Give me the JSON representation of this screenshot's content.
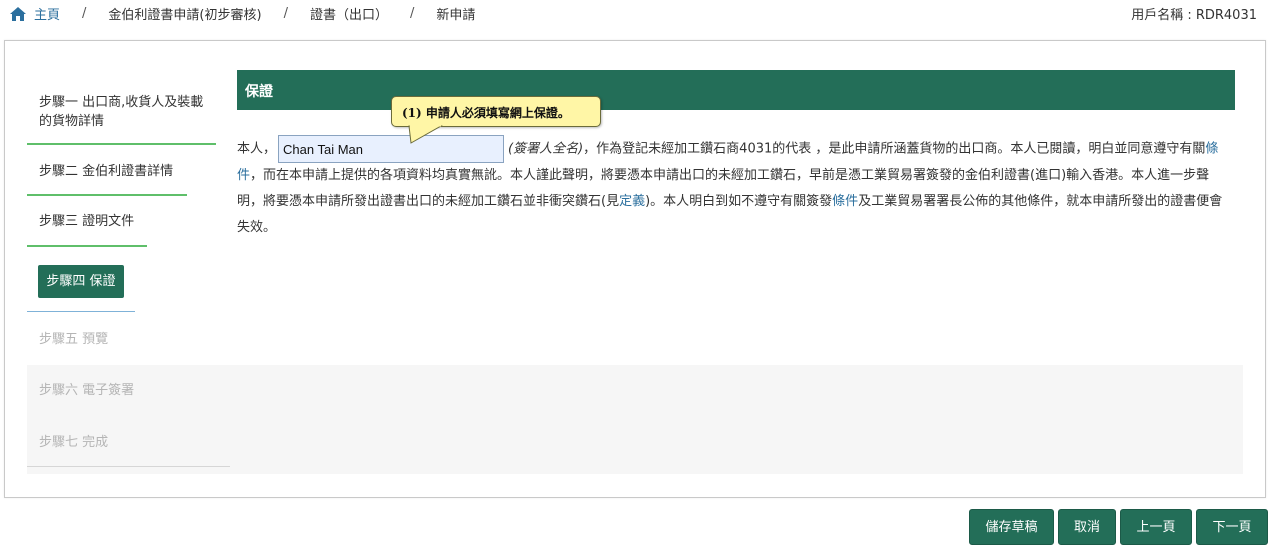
{
  "breadcrumb": {
    "home": "主頁",
    "items": [
      "金伯利證書申請(初步審核)",
      "證書（出口）",
      "新申請"
    ],
    "separator": "/"
  },
  "user_label": "用戶名稱 : RDR4031",
  "steps": [
    {
      "label": "步驟一 出口商,收貨人及裝載的貨物詳情",
      "state": "done"
    },
    {
      "label": "步驟二 金伯利證書詳情",
      "state": "done"
    },
    {
      "label": "步驟三 證明文件",
      "state": "done"
    },
    {
      "label": "步驟四 保證",
      "state": "active"
    },
    {
      "label": "步驟五 預覽",
      "state": "disabled"
    },
    {
      "label": "步驟六 電子簽署",
      "state": "disabled"
    },
    {
      "label": "步驟七 完成",
      "state": "disabled"
    }
  ],
  "section": {
    "title": "保證",
    "tooltip": "(1) 申請人必須填寫網上保證。"
  },
  "declaration": {
    "prefix": "本人，",
    "name_value": "Chan Tai Man",
    "name_hint": "(簽署人全名)",
    "text_1": "，作為登記未經加工鑽石商4031的代表 ，是此申請所涵蓋貨物的出口商。本人已閱讀，明白並同意遵守有關",
    "link_conditions": "條件",
    "text_2": "，而在本申請上提供的各項資料均真實無訛。本人謹此聲明，將要憑本申請出口的未經加工鑽石，早前是憑工業貿易署簽發的金伯利證書(進口)輸入香港。本人進一步聲明，將要憑本申請所發出證書出口的未經加工鑽石並非衝突鑽石(見",
    "link_definition": "定義",
    "text_3": ")。本人明白到如不遵守有關簽發",
    "link_conditions_2": "條件",
    "text_4": "及工業貿易署署長公佈的其他條件，就本申請所發出的證書便會失效。"
  },
  "buttons": {
    "save_draft": "儲存草稿",
    "cancel": "取消",
    "prev": "上一頁",
    "next": "下一頁"
  },
  "colors": {
    "primary": "#236e58",
    "link": "#2b6f9e",
    "tooltip_bg": "#fff6a6",
    "step_line_done": "#5fbf6a",
    "step_line_active": "#7fb2d8"
  }
}
